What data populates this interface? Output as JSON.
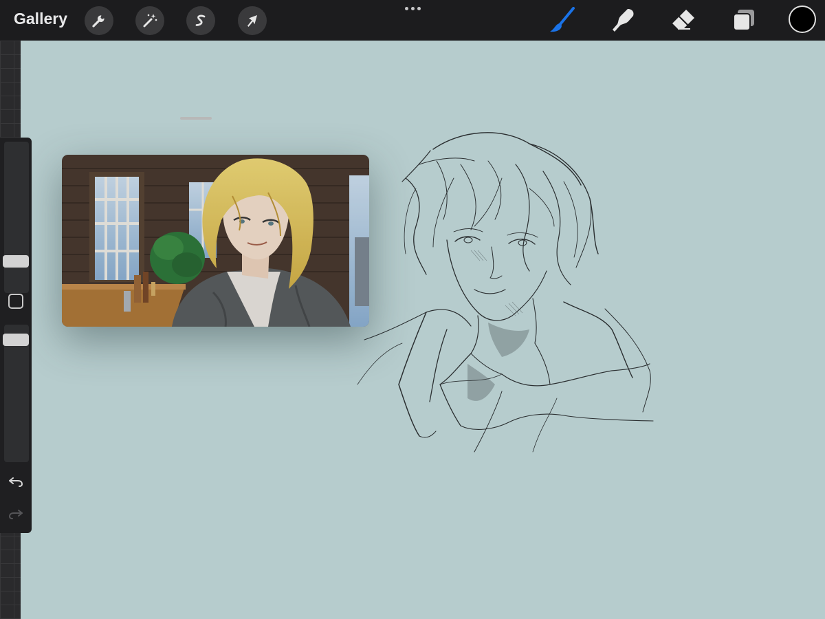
{
  "app": {
    "gallery_label": "Gallery"
  },
  "toolbar": {
    "left_tools": [
      "actions",
      "adjustments",
      "selection",
      "transform"
    ],
    "right_tools": [
      "brush",
      "smudge",
      "eraser",
      "layers"
    ],
    "active_tool": "brush",
    "active_color": "#000000",
    "accent_color": "#1a73e8"
  },
  "sidebar": {
    "brush_size": 0.62,
    "opacity": 0.6
  },
  "canvas": {
    "background_color": "#b6cccd"
  },
  "reference": {
    "visible": true
  }
}
